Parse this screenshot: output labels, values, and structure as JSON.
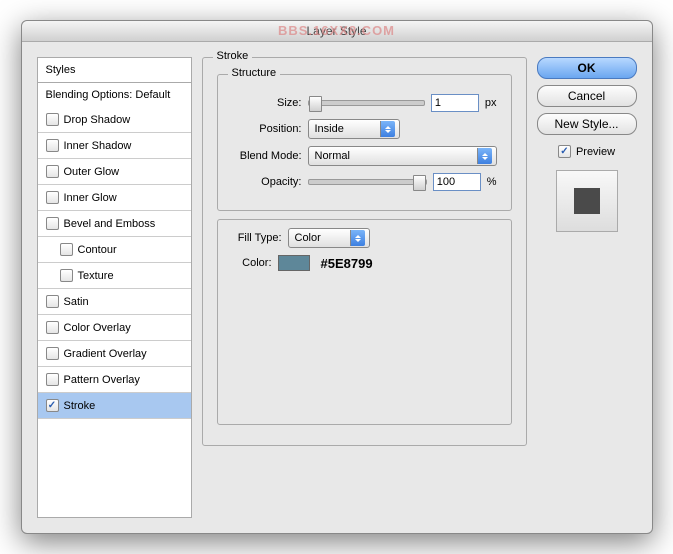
{
  "watermark": "BBS.16XX8.COM",
  "title": "Layer Style",
  "sidebar": {
    "header": "Styles",
    "divider": "Blending Options: Default",
    "items": [
      {
        "label": "Drop Shadow",
        "checked": false,
        "indent": false
      },
      {
        "label": "Inner Shadow",
        "checked": false,
        "indent": false
      },
      {
        "label": "Outer Glow",
        "checked": false,
        "indent": false
      },
      {
        "label": "Inner Glow",
        "checked": false,
        "indent": false
      },
      {
        "label": "Bevel and Emboss",
        "checked": false,
        "indent": false
      },
      {
        "label": "Contour",
        "checked": false,
        "indent": true
      },
      {
        "label": "Texture",
        "checked": false,
        "indent": true
      },
      {
        "label": "Satin",
        "checked": false,
        "indent": false
      },
      {
        "label": "Color Overlay",
        "checked": false,
        "indent": false
      },
      {
        "label": "Gradient Overlay",
        "checked": false,
        "indent": false
      },
      {
        "label": "Pattern Overlay",
        "checked": false,
        "indent": false
      },
      {
        "label": "Stroke",
        "checked": true,
        "indent": false,
        "selected": true
      }
    ]
  },
  "panel": {
    "title": "Stroke",
    "structure": {
      "legend": "Structure",
      "size_label": "Size:",
      "size_value": "1",
      "size_unit": "px",
      "position_label": "Position:",
      "position_value": "Inside",
      "mode_label": "Blend Mode:",
      "mode_value": "Normal",
      "opacity_label": "Opacity:",
      "opacity_value": "100",
      "opacity_unit": "%"
    },
    "fill": {
      "type_label": "Fill Type:",
      "type_value": "Color",
      "color_label": "Color:",
      "color_hex": "#5E8799",
      "swatch": "#5E8799"
    }
  },
  "buttons": {
    "ok": "OK",
    "cancel": "Cancel",
    "newstyle": "New Style...",
    "preview": "Preview"
  }
}
